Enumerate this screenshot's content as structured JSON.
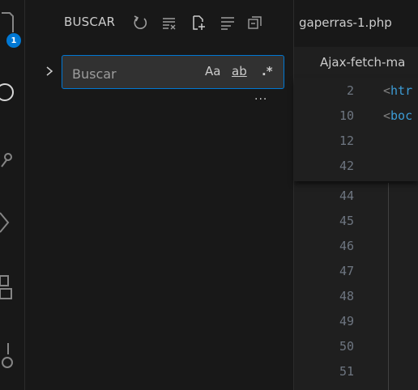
{
  "sidebar": {
    "title": "BUSCAR",
    "search": {
      "placeholder": "Buscar",
      "value": "",
      "match_case": "Aa",
      "whole_word": "ab",
      "regex": ".*"
    },
    "more": "···"
  },
  "activity_bar": {
    "badge": "1",
    "icons": [
      "explorer-icon",
      "search-icon",
      "source-control-icon",
      "run-debug-icon",
      "extensions-icon",
      "remote-icon"
    ]
  },
  "editor": {
    "tab_label": "gaperras-1.php",
    "breadcrumb": "Ajax-fetch-ma",
    "sticky_lines": [
      {
        "n": "2",
        "code": "<htr"
      },
      {
        "n": "10",
        "code": "<boc"
      },
      {
        "n": "12",
        "code": ""
      },
      {
        "n": "42",
        "code": ""
      }
    ],
    "lines": [
      "44",
      "45",
      "46",
      "47",
      "48",
      "49",
      "50",
      "51"
    ]
  },
  "colors": {
    "accent": "#0078d4",
    "sidebar_bg": "#181818",
    "editor_bg": "#1f1f1f",
    "tag": "#3c9cd6",
    "line_number": "#6e7681"
  }
}
